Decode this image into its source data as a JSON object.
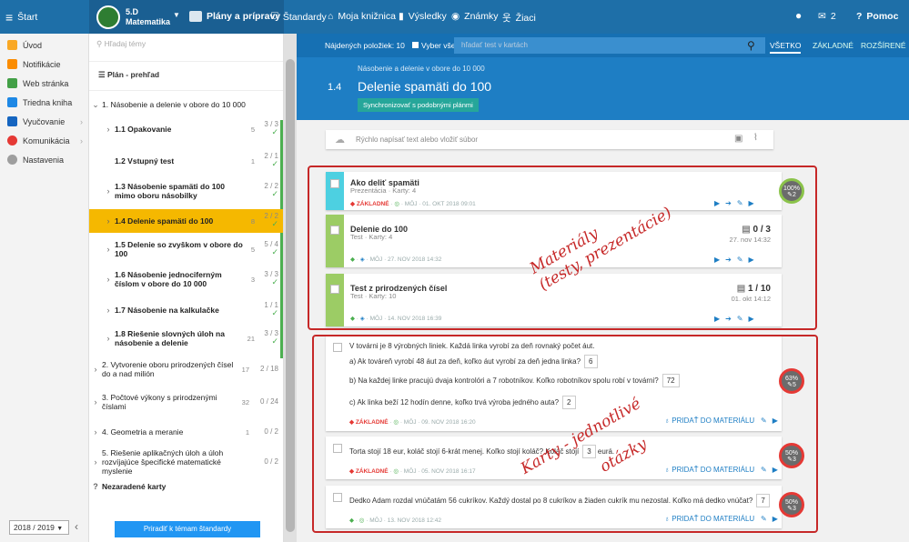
{
  "topbar": {
    "start": "Štart",
    "class_name": "5.D",
    "subject": "Matematika",
    "nav": [
      "Plány a prípravy",
      "Štandardy",
      "Moja knižnica",
      "Výsledky",
      "Známky",
      "Žiaci"
    ],
    "messages_count": "2",
    "help": "Pomoc"
  },
  "sidebar": {
    "items": [
      "Úvod",
      "Notifikácie",
      "Web stránka",
      "Triedna kniha",
      "Vyučovanie",
      "Komunikácia",
      "Nastavenia"
    ],
    "year": "2018 / 2019"
  },
  "plan": {
    "search_placeholder": "Hľadaj témy",
    "overview": "Plán - prehľad",
    "chapter1": "1. Násobenie a delenie v obore do 10 000",
    "lessons": [
      {
        "label": "1.1 Opakovanie",
        "num": "5",
        "frac": "3 / 3"
      },
      {
        "label": "1.2 Vstupný test",
        "num": "1",
        "frac": "2 / 1"
      },
      {
        "label": "1.3 Násobenie spamäti do 100 mimo oboru násobilky",
        "num": "",
        "frac": "2 / 2"
      },
      {
        "label": "1.4 Delenie spamäti do 100",
        "num": "8",
        "frac": "2 / 2"
      },
      {
        "label": "1.5 Delenie so zvyškom v obore do 100",
        "num": "5",
        "frac": "5 / 4"
      },
      {
        "label": "1.6 Násobenie jednociferným číslom v obore do 10 000",
        "num": "3",
        "frac": "3 / 3"
      },
      {
        "label": "1.7 Násobenie na kalkulačke",
        "num": "",
        "frac": "1 / 1"
      },
      {
        "label": "1.8 Riešenie slovných úloh na násobenie a delenie",
        "num": "21",
        "frac": "3 / 3"
      }
    ],
    "chapters": [
      {
        "label": "2. Vytvorenie oboru prirodzených čísel do a nad milión",
        "num": "17",
        "frac": "2 / 18"
      },
      {
        "label": "3. Počtové výkony s prirodzenými číslami",
        "num": "32",
        "frac": "0 / 24"
      },
      {
        "label": "4. Geometria a meranie",
        "num": "1",
        "frac": "0 / 2"
      },
      {
        "label": "5. Riešenie aplikačných úloh a úloh rozvíjajúce špecifické matematické myslenie",
        "num": "",
        "frac": "0 / 2"
      }
    ],
    "unassigned": "Nezaradené karty",
    "assign_button": "Priradiť k témam štandardy"
  },
  "toolbar": {
    "found": "Nájdených položiek: 10",
    "select_all": "Vyber všetko",
    "search_placeholder": "hľadať test v kartách",
    "filters": [
      "VŠETKO",
      "ZÁKLADNÉ",
      "ROZŠÍRENÉ"
    ]
  },
  "header": {
    "breadcrumb": "Násobenie a delenie v obore do 10 000",
    "number": "1.4",
    "title": "Delenie spamäti do 100",
    "sync_button": "Synchronizovať s podobnými plánmi"
  },
  "quick_input_placeholder": "Rýchlo napísať text alebo vložiť súbor",
  "materials": [
    {
      "title": "Ako deliť spamäti",
      "sub": "Prezentácia · Karty: 4",
      "meta": "· MÔJ · 01. OKT 2018 09:01",
      "tag": "ZÁKLADNÉ",
      "badge": "100%",
      "badge_sub": "2",
      "score": "",
      "score_date": ""
    },
    {
      "title": "Delenie do 100",
      "sub": "Test · Karty: 4",
      "meta": "· MÔJ · 27. NOV 2018 14:32",
      "tag": "",
      "badge": "",
      "badge_sub": "",
      "score": "0 / 3",
      "score_date": "27. nov 14:32"
    },
    {
      "title": "Test z prirodzených čísel",
      "sub": "Test · Karty: 10",
      "meta": "· MÔJ · 14. NOV 2018 16:39",
      "tag": "",
      "badge": "",
      "badge_sub": "",
      "score": "1 / 10",
      "score_date": "01. okt 14:12"
    }
  ],
  "questions": [
    {
      "intro": "V továrni je 8 výrobných liniek. Každá linka vyrobí za deň rovnaký počet áut.",
      "parts": [
        {
          "q": "a) Ak továreň vyrobí 48 áut za deň, koľko áut vyrobí za deň jedna linka?",
          "a": "6"
        },
        {
          "q": "b) Na každej linke pracujú dvaja kontrolóri a 7 robotníkov. Koľko robotníkov spolu robí v továrni?",
          "a": "72"
        },
        {
          "q": "c) Ak linka beží 12 hodín denne, koľko trvá výroba jedného auta?",
          "a": "2"
        }
      ],
      "meta": "· MÔJ · 09. NOV 2018 16:20",
      "tag": "ZÁKLADNÉ",
      "badge": "63%",
      "badge_sub": "5"
    },
    {
      "text": "Torta stojí 18 eur, koláč stojí 6-krát menej. Koľko stojí koláč? Koláč stojí",
      "answer": "3",
      "suffix": "eurá.",
      "meta": "· MÔJ · 05. NOV 2018 16:17",
      "tag": "ZÁKLADNÉ",
      "badge": "50%",
      "badge_sub": "3"
    },
    {
      "text": "Dedko Adam rozdal vnúčatám 56 cukríkov. Každý dostal po 8 cukríkov a žiaden cukrík mu nezostal. Koľko má dedko vnúčat?",
      "answer": "7",
      "meta": "· MÔJ · 13. NOV 2018 12:42",
      "tag": "",
      "badge": "50%",
      "badge_sub": "3"
    }
  ],
  "add_to_material": "PRIDAŤ DO MATERIÁLU",
  "annotations": {
    "materials_line1": "Materiály",
    "materials_line2": "(testy, prezentácie)",
    "cards_line1": "Karty - jednotlivé",
    "cards_line2": "otázky"
  },
  "colors": {
    "topbar": "#1e6fa8",
    "header": "#1e7ec4",
    "active_lesson": "#f5b800",
    "green": "#4caf50",
    "annotation": "#c62828"
  }
}
